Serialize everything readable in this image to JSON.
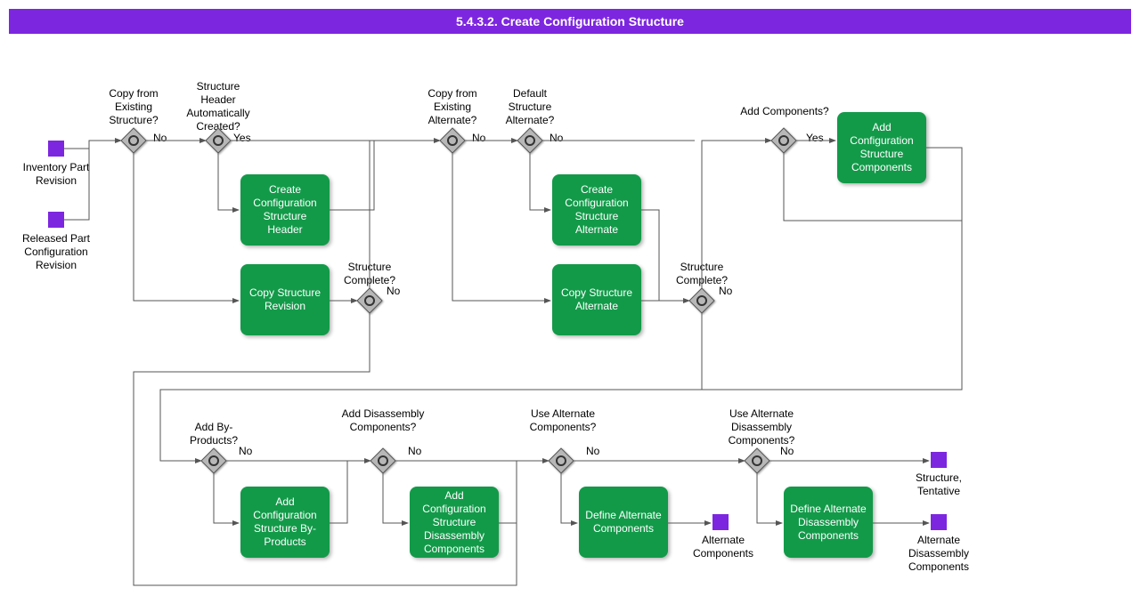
{
  "title": "5.4.3.2. Create Configuration Structure",
  "starts": {
    "inv": "Inventory Part Revision",
    "rel": "Released Part Configuration Revision"
  },
  "gateways": {
    "g1": "Copy from Existing Structure?",
    "g2": "Structure Header Automatically Created?",
    "g3": "Structure Complete?",
    "g4": "Copy from Existing Alternate?",
    "g5": "Default Structure Alternate?",
    "g6": "Structure Complete?",
    "g7": "Add Components?",
    "g8": "Add By-Products?",
    "g9": "Add Disassembly Components?",
    "g10": "Use Alternate Components?",
    "g11": "Use Alternate Disassembly Components?"
  },
  "tasks": {
    "t1": "Create Configuration Structure Header",
    "t2": "Copy Structure Revision",
    "t3": "Create Configuration Structure Alternate",
    "t4": "Copy Structure Alternate",
    "t5": "Add Configuration Structure Components",
    "t6": "Add Configuration Structure By-Products",
    "t7": "Add Configuration Structure Disassembly Components",
    "t8": "Define Alternate Components",
    "t9": "Define Alternate Disassembly Components"
  },
  "ends": {
    "e1": "Structure, Tentative",
    "e2": "Alternate Components",
    "e3": "Alternate Disassembly Components"
  },
  "labels": {
    "yes": "Yes",
    "no": "No"
  },
  "colors": {
    "accent": "#7d26e0",
    "task": "#129a49"
  }
}
